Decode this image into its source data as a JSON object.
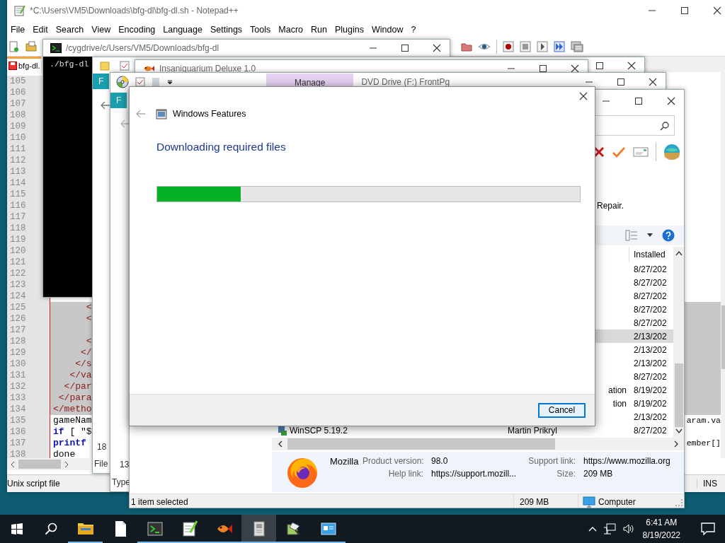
{
  "notepad": {
    "title": "*C:\\Users\\VM5\\Downloads\\bfg-dl\\bfg-dl.sh - Notepad++",
    "menu": [
      "File",
      "Edit",
      "Search",
      "View",
      "Encoding",
      "Language",
      "Settings",
      "Tools",
      "Macro",
      "Run",
      "Plugins",
      "Window",
      "?"
    ],
    "tab": "bfg-dl.",
    "lines": [
      {
        "number": "105"
      },
      {
        "number": "106"
      },
      {
        "number": "107"
      },
      {
        "number": "108"
      },
      {
        "number": "109"
      },
      {
        "number": "110"
      },
      {
        "number": "111"
      },
      {
        "number": "112"
      },
      {
        "number": "113"
      },
      {
        "number": "114"
      },
      {
        "number": "115"
      },
      {
        "number": "116"
      },
      {
        "number": "117"
      },
      {
        "number": "118"
      },
      {
        "number": "119"
      },
      {
        "number": "120"
      },
      {
        "number": "121"
      },
      {
        "number": "122"
      },
      {
        "number": "123"
      },
      {
        "number": "124"
      },
      {
        "number": "125",
        "kind": "tag",
        "code": "      <",
        "selected": true
      },
      {
        "number": "126",
        "kind": "tag",
        "code": "      <",
        "selected": true
      },
      {
        "number": "127",
        "selected": true
      },
      {
        "number": "128",
        "kind": "tag",
        "code": "      <",
        "selected": true
      },
      {
        "number": "129",
        "kind": "tag",
        "code": "     </",
        "selected": true
      },
      {
        "number": "130",
        "kind": "tag",
        "code": "    </s",
        "selected": true
      },
      {
        "number": "131",
        "kind": "tag",
        "code": "   </va",
        "selected": true
      },
      {
        "number": "132",
        "kind": "tag",
        "code": "  </par",
        "selected": true
      },
      {
        "number": "133",
        "kind": "tag",
        "code": " </para",
        "selected": true
      },
      {
        "number": "134",
        "kind": "tag",
        "code": "</metho",
        "selected": true
      },
      {
        "number": "135",
        "kind": "plain",
        "code": "gameNam",
        "tail": "aram.va",
        "selected": false
      },
      {
        "number": "136",
        "kind": "keyword",
        "keyword": "if",
        "code": " [ \"$",
        "selected": false
      },
      {
        "number": "137",
        "kind": "keyword",
        "keyword": "printf",
        "tail": "ember[]",
        "selected": false
      },
      {
        "number": "138",
        "kind": "plain",
        "code": "done",
        "selected": false
      }
    ],
    "status": "Unix script file",
    "mode": "INS"
  },
  "terminal": {
    "title": "/cygdrive/c/Users/VM5/Downloads/bfg-dl",
    "output": "./bfg-dl"
  },
  "explorer_1": {
    "tab": "F",
    "column_1": "18",
    "column_2": "File"
  },
  "game_window": {
    "title": "Insaniquarium Deluxe 1.0"
  },
  "explorer_2": {
    "ribbon_tab": "Manage",
    "title": "DVD Drive (F:) FrontPg",
    "tab": "F",
    "column_1": "13",
    "column_2": "Type"
  },
  "programs": {
    "hint": "Repair.",
    "column": "Installed",
    "rows": [
      {
        "date": "8/27/202",
        "selected": false
      },
      {
        "date": "8/27/202",
        "selected": false
      },
      {
        "date": "8/27/202",
        "selected": false
      },
      {
        "date": "8/27/202",
        "selected": false
      },
      {
        "date": "8/27/202",
        "selected": false
      },
      {
        "date": "2/13/202",
        "selected": true
      },
      {
        "date": "2/13/202",
        "selected": false
      },
      {
        "date": "2/13/202",
        "selected": false
      },
      {
        "date": "8/27/202",
        "selected": false
      },
      {
        "publisher": "ation",
        "date": "8/19/202",
        "selected": false
      },
      {
        "publisher": "tion",
        "date": "8/19/202",
        "selected": false
      },
      {
        "date": "2/13/202",
        "selected": false
      },
      {
        "name": "WinSCP 5.19.2",
        "publisher": "Martin Prikryl",
        "date": "8/27/202",
        "selected": false
      }
    ],
    "details": {
      "publisher": "Mozilla",
      "fields": [
        {
          "label": "Product version:",
          "value": "98.0"
        },
        {
          "label": "Support link:",
          "value": "https://www.mozilla.org"
        },
        {
          "label": "Help link:",
          "value": "https://support.mozill..."
        },
        {
          "label": "Size:",
          "value": "209 MB"
        }
      ]
    },
    "status": [
      "1 item selected",
      "209 MB",
      "Computer"
    ]
  },
  "dialog": {
    "title": "Windows Features",
    "heading": "Downloading required files",
    "progress": {
      "level": 0.197
    },
    "button": "Cancel"
  },
  "taskbar": {
    "apps": [
      {
        "kind": "folder",
        "running": true,
        "selected": false
      },
      {
        "kind": "document",
        "running": false,
        "selected": false
      },
      {
        "kind": "terminal",
        "running": true,
        "selected": false
      },
      {
        "kind": "notepad",
        "running": true,
        "selected": false
      },
      {
        "kind": "fish",
        "running": true,
        "selected": false
      },
      {
        "kind": "installer",
        "running": true,
        "selected": true
      },
      {
        "kind": "features",
        "running": true,
        "selected": false
      },
      {
        "kind": "panel",
        "running": true,
        "selected": false
      }
    ],
    "clock": {
      "time": "6:41 AM",
      "date": "8/19/2022"
    }
  }
}
